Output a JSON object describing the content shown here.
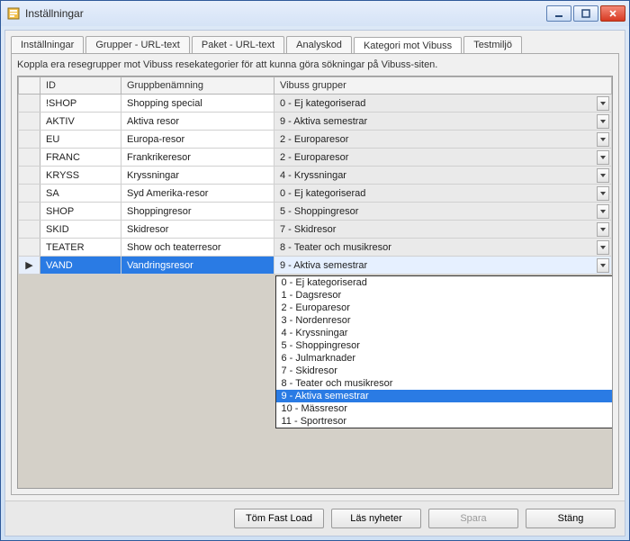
{
  "window": {
    "title": "Inställningar"
  },
  "tabs": [
    {
      "label": "Inställningar"
    },
    {
      "label": "Grupper - URL-text"
    },
    {
      "label": "Paket - URL-text"
    },
    {
      "label": "Analyskod"
    },
    {
      "label": "Kategori mot Vibuss"
    },
    {
      "label": "Testmiljö"
    }
  ],
  "active_tab_index": 4,
  "description": "Koppla era resegrupper mot Vibuss resekategorier för att kunna göra sökningar på Vibuss-siten.",
  "columns": {
    "id": "ID",
    "name": "Gruppbenämning",
    "vibuss": "Vibuss grupper"
  },
  "rows": [
    {
      "id": "!SHOP",
      "name": "Shopping special",
      "vibuss": "0 - Ej kategoriserad"
    },
    {
      "id": "AKTIV",
      "name": "Aktiva resor",
      "vibuss": "9 - Aktiva semestrar"
    },
    {
      "id": "EU",
      "name": "Europa-resor",
      "vibuss": "2 - Europaresor"
    },
    {
      "id": "FRANC",
      "name": "Frankrikeresor",
      "vibuss": "2 - Europaresor"
    },
    {
      "id": "KRYSS",
      "name": "Kryssningar",
      "vibuss": "4 - Kryssningar"
    },
    {
      "id": "SA",
      "name": "Syd Amerika-resor",
      "vibuss": "0 - Ej kategoriserad"
    },
    {
      "id": "SHOP",
      "name": "Shoppingresor",
      "vibuss": "5 - Shoppingresor"
    },
    {
      "id": "SKID",
      "name": "Skidresor",
      "vibuss": "7 - Skidresor"
    },
    {
      "id": "TEATER",
      "name": "Show och teaterresor",
      "vibuss": "8 - Teater och musikresor"
    },
    {
      "id": "VAND",
      "name": "Vandringsresor",
      "vibuss": "9 - Aktiva semestrar"
    }
  ],
  "selected_row_index": 9,
  "dropdown": {
    "open_for_row_index": 9,
    "highlight_index": 9,
    "options": [
      "0 - Ej kategoriserad",
      "1 - Dagsresor",
      "2 - Europaresor",
      "3 - Nordenresor",
      "4 - Kryssningar",
      "5 - Shoppingresor",
      "6 - Julmarknader",
      "7 - Skidresor",
      "8 - Teater och musikresor",
      "9 - Aktiva semestrar",
      "10 - Mässresor",
      "11 - Sportresor"
    ]
  },
  "footer": {
    "clear_fast_load": "Töm Fast Load",
    "read_news": "Läs nyheter",
    "save": "Spara",
    "close": "Stäng",
    "save_enabled": false
  }
}
